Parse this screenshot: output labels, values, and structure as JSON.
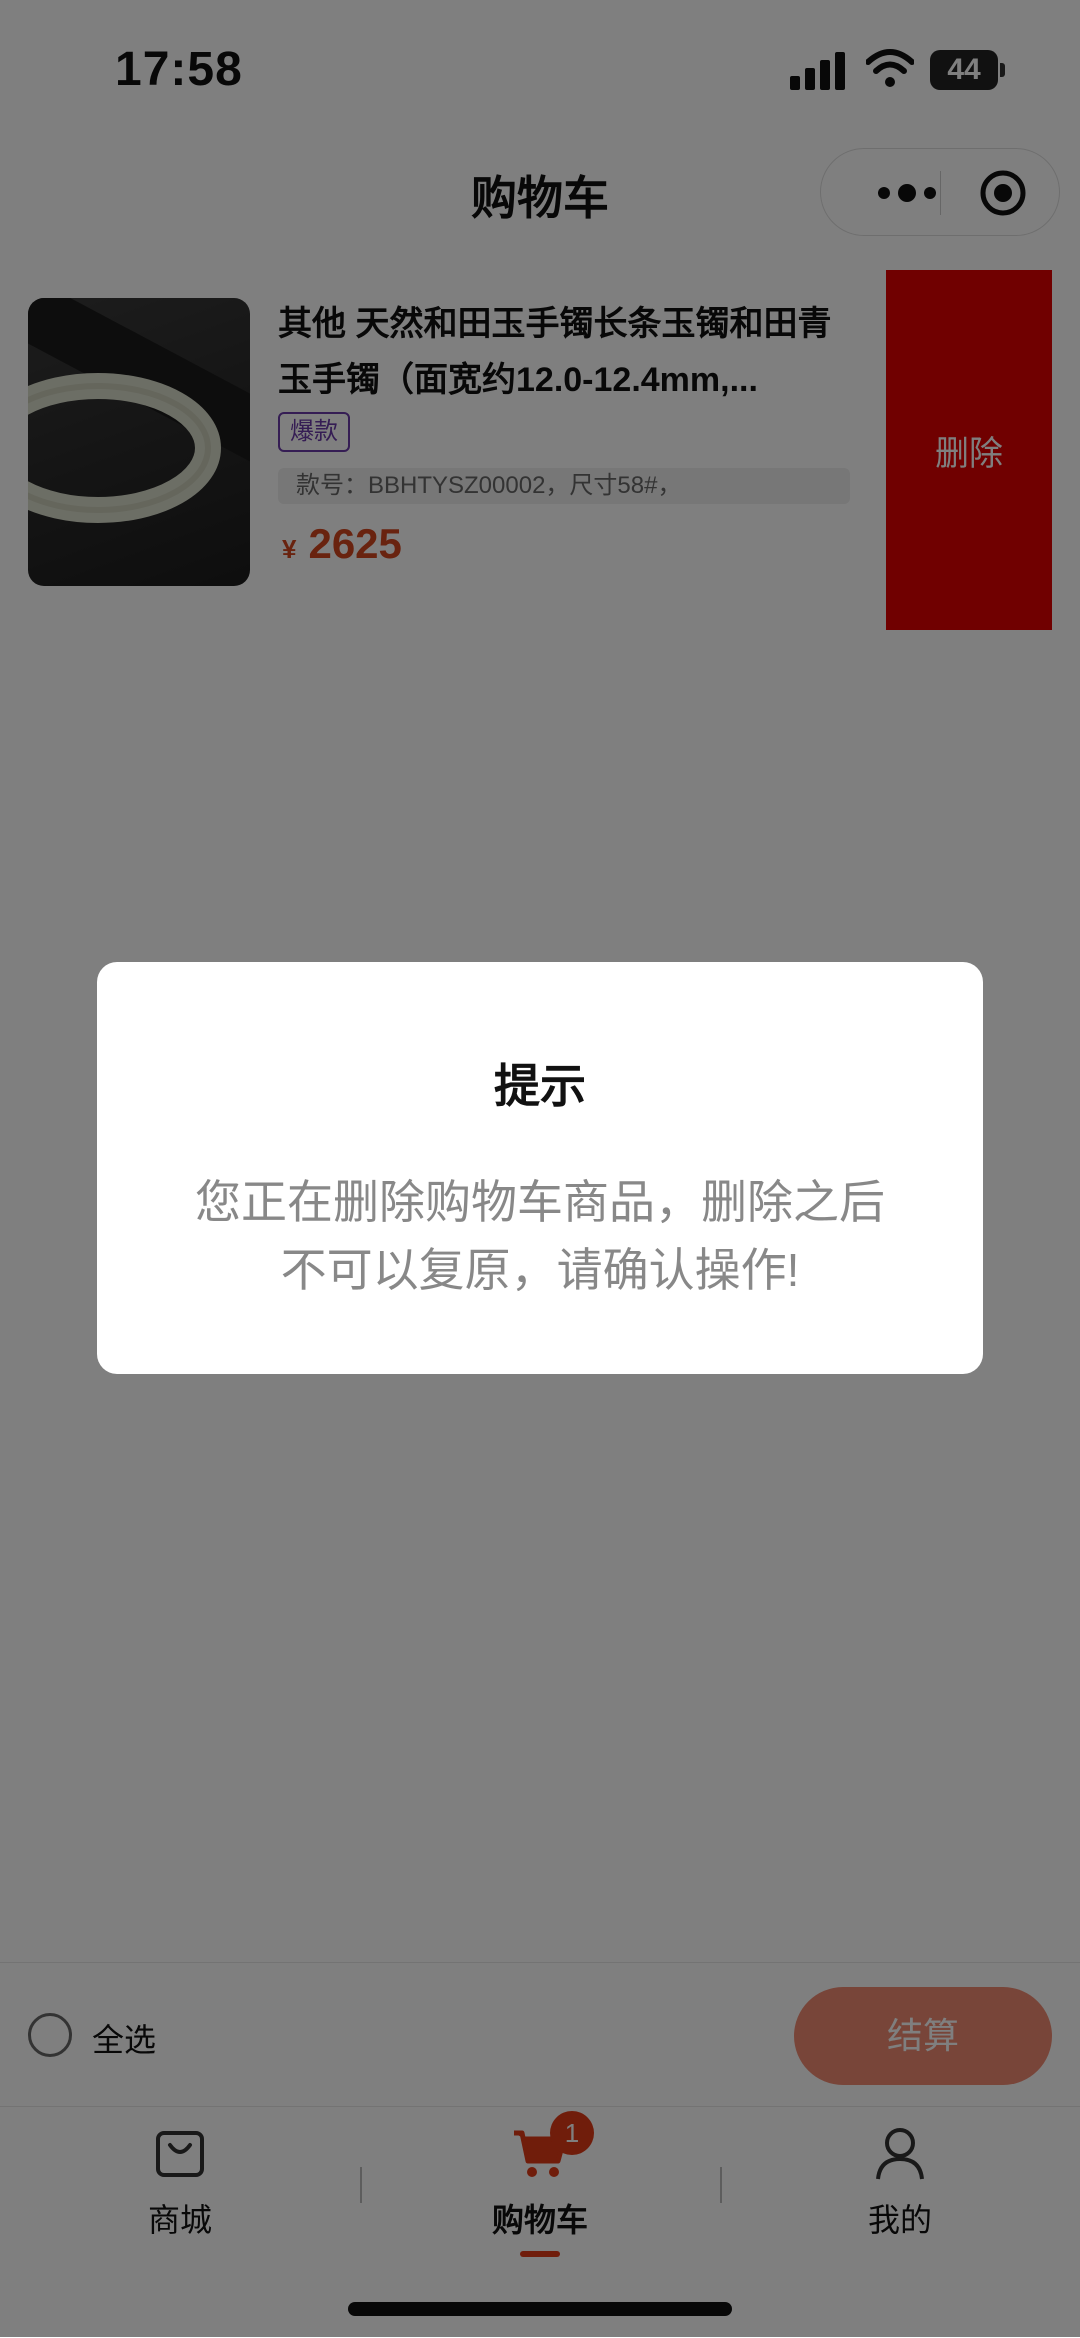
{
  "status_bar": {
    "time": "17:58",
    "battery": "44"
  },
  "navbar": {
    "title": "购物车"
  },
  "cart_item": {
    "title": "其他 天然和田玉手镯长条玉镯和田青玉手镯（面宽约12.0-12.4mm,...",
    "tag": "爆款",
    "spec": "款号：BBHTYSZ00002，尺寸58#，",
    "currency": "¥",
    "price": "2625",
    "delete_label": "删除"
  },
  "checkout_bar": {
    "select_all_label": "全选",
    "checkout_label": "结算"
  },
  "tabbar": {
    "items": [
      {
        "label": "商城",
        "icon": "shopping-bag-icon"
      },
      {
        "label": "购物车",
        "icon": "cart-icon",
        "badge": "1",
        "active": true
      },
      {
        "label": "我的",
        "icon": "user-icon"
      }
    ]
  },
  "dialog": {
    "title": "提示",
    "message_line1": "您正在删除购物车商品，删除之后",
    "message_line2": "不可以复原，请确认操作!"
  },
  "colors": {
    "accent": "#e03a16",
    "delete_red": "#e00000",
    "tag_purple": "#6a3aa8"
  }
}
